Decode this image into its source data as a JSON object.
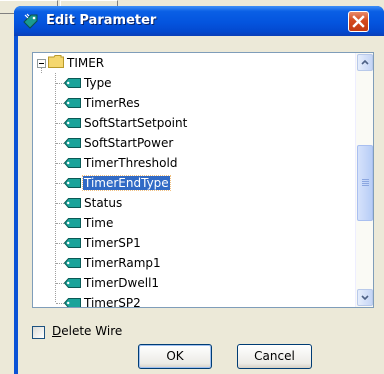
{
  "window": {
    "title": "Edit Parameter",
    "title_icon": "tag-pencil-icon",
    "close_icon": "close-icon"
  },
  "tree": {
    "root": {
      "label": "TIMER",
      "icon": "folder-icon",
      "expander": "collapse-minus-icon"
    },
    "items": [
      {
        "label": "Type"
      },
      {
        "label": "TimerRes"
      },
      {
        "label": "SoftStartSetpoint"
      },
      {
        "label": "SoftStartPower"
      },
      {
        "label": "TimerThreshold"
      },
      {
        "label": "TimerEndType",
        "selected": true
      },
      {
        "label": "Status"
      },
      {
        "label": "Time"
      },
      {
        "label": "TimerSP1"
      },
      {
        "label": "TimerRamp1"
      },
      {
        "label": "TimerDwell1"
      },
      {
        "label": "TimerSP2"
      }
    ],
    "item_icon": "tag-icon"
  },
  "delete_wire": {
    "label_prefix": "",
    "accel": "D",
    "label_rest": "elete Wire",
    "checked": false
  },
  "buttons": {
    "ok": "OK",
    "cancel": "Cancel"
  },
  "colors": {
    "titlebar": "#0454de",
    "selection": "#316ac5",
    "close": "#d44a1e"
  }
}
